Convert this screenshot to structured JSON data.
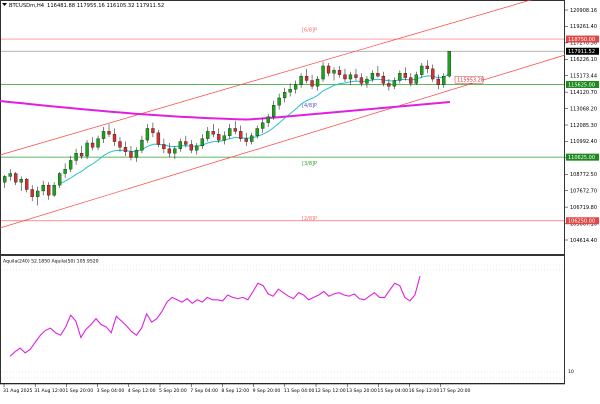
{
  "header": {
    "symbol": "BTCUSDm,H4",
    "ohlc": "116481.88 117955.16 116105.32 117911.52"
  },
  "indicator": {
    "label": "Aquila(240) 52.1850 Aquila(50) 105.9520",
    "scale": {
      "top": "",
      "mid": "",
      "bottom": "10"
    }
  },
  "murrey_labels": [
    {
      "text": "[6/8]P",
      "price": 119200
    },
    {
      "text": "[4/8]P",
      "price": 114000
    },
    {
      "text": "[3/8]P",
      "price": 110000
    },
    {
      "text": "[2/8]P",
      "price": 106250
    }
  ],
  "price_scale_labels": [
    "120908.16",
    "119261.40",
    "117270.56",
    "116226.10",
    "115173.44",
    "114120.70",
    "113068.20",
    "112085.30",
    "110992.40",
    "109979.80",
    "108772.50",
    "107672.70",
    "106719.80",
    "105667.10",
    "104614.40"
  ],
  "price_tags": [
    {
      "text": "118750.00",
      "color": "#e04848",
      "price": 118750
    },
    {
      "text": "117911.52",
      "color": "#000000",
      "price": 117911
    },
    {
      "text": "115625.00",
      "color": "#1e8a1e",
      "price": 115625
    },
    {
      "text": "110625.00",
      "color": "#1e8a1e",
      "price": 110625
    },
    {
      "text": "106250.00",
      "color": "#e04848",
      "price": 106250
    }
  ],
  "inline_tag": {
    "text": "115953.28",
    "price": 115953
  },
  "time_labels": [
    "31 Aug 2025",
    "31 Aug 12:00",
    "1 Sep 20:00",
    "3 Sep 04:00",
    "4 Sep 12:00",
    "5 Sep 20:00",
    "7 Sep 04:00",
    "8 Sep 12:00",
    "9 Sep 20:00",
    "11 Sep 04:00",
    "12 Sep 12:00",
    "13 Sep 20:00",
    "15 Sep 04:00",
    "16 Sep 12:00",
    "17 Sep 20:00"
  ],
  "colors": {
    "bull": "#1aa31a",
    "bear": "#d03030",
    "ma_fast": "#27c2c9",
    "ma_slow": "#e020e0",
    "channel": "#ff4040",
    "level_red": "#ff6a6a",
    "level_green": "#2aa02a",
    "oscillator": "#e020e0"
  },
  "chart_data": {
    "type": "candlestick",
    "y_range": [
      104100,
      121300
    ],
    "candles": [
      [
        108900,
        109400,
        108500,
        109300
      ],
      [
        109300,
        109800,
        109000,
        109500
      ],
      [
        109500,
        109600,
        108700,
        108900
      ],
      [
        108900,
        109300,
        108300,
        109100
      ],
      [
        109100,
        109200,
        108200,
        108400
      ],
      [
        108400,
        108700,
        107600,
        107900
      ],
      [
        107900,
        108600,
        107300,
        108300
      ],
      [
        108300,
        109000,
        108000,
        108700
      ],
      [
        108700,
        108900,
        107700,
        108000
      ],
      [
        108000,
        108900,
        107900,
        108700
      ],
      [
        108700,
        109600,
        108500,
        109500
      ],
      [
        109500,
        110200,
        109200,
        109800
      ],
      [
        109800,
        110700,
        109600,
        110400
      ],
      [
        110400,
        111200,
        110100,
        110900
      ],
      [
        110900,
        111400,
        110500,
        110700
      ],
      [
        110700,
        111800,
        110500,
        111600
      ],
      [
        111600,
        112000,
        111100,
        111300
      ],
      [
        111300,
        112100,
        111100,
        111900
      ],
      [
        111900,
        112700,
        111600,
        112400
      ],
      [
        112400,
        112900,
        112000,
        112200
      ],
      [
        112200,
        112600,
        111400,
        111700
      ],
      [
        111700,
        112000,
        111000,
        111300
      ],
      [
        111300,
        111700,
        110700,
        111000
      ],
      [
        111000,
        111400,
        110400,
        110600
      ],
      [
        110600,
        111300,
        110300,
        111100
      ],
      [
        111100,
        112100,
        110900,
        111800
      ],
      [
        111800,
        112900,
        111600,
        112600
      ],
      [
        112600,
        113000,
        112000,
        112300
      ],
      [
        112300,
        112500,
        111300,
        111500
      ],
      [
        111500,
        111900,
        110900,
        111200
      ],
      [
        111200,
        111600,
        110600,
        110900
      ],
      [
        110900,
        111400,
        110500,
        111200
      ],
      [
        111200,
        111900,
        111000,
        111700
      ],
      [
        111700,
        112100,
        111300,
        111500
      ],
      [
        111500,
        111800,
        110900,
        111100
      ],
      [
        111100,
        111600,
        110800,
        111400
      ],
      [
        111400,
        112200,
        111200,
        111900
      ],
      [
        111900,
        112700,
        111700,
        112400
      ],
      [
        112400,
        112900,
        112000,
        112200
      ],
      [
        112200,
        112600,
        111600,
        111800
      ],
      [
        111800,
        112400,
        111500,
        112100
      ],
      [
        112100,
        112900,
        111900,
        112600
      ],
      [
        112600,
        113100,
        112200,
        112400
      ],
      [
        112400,
        112800,
        111700,
        111900
      ],
      [
        111900,
        112300,
        111400,
        111700
      ],
      [
        111700,
        112300,
        111500,
        112100
      ],
      [
        112100,
        112800,
        111900,
        112600
      ],
      [
        112600,
        113300,
        112300,
        113000
      ],
      [
        113000,
        113600,
        112700,
        113400
      ],
      [
        113400,
        114500,
        113200,
        114200
      ],
      [
        114200,
        115000,
        113900,
        114700
      ],
      [
        114700,
        115400,
        114400,
        115100
      ],
      [
        115100,
        115700,
        114800,
        115300
      ],
      [
        115300,
        115900,
        115000,
        115600
      ],
      [
        115600,
        116400,
        115400,
        116200
      ],
      [
        116200,
        116700,
        115700,
        115900
      ],
      [
        115900,
        116300,
        115300,
        115500
      ],
      [
        115500,
        116200,
        115200,
        116000
      ],
      [
        116000,
        117200,
        115800,
        116900
      ],
      [
        116900,
        117100,
        116200,
        116400
      ],
      [
        116400,
        116800,
        115900,
        116600
      ],
      [
        116600,
        116900,
        116100,
        116300
      ],
      [
        116300,
        116700,
        115800,
        116000
      ],
      [
        116000,
        116500,
        115600,
        116300
      ],
      [
        116300,
        116700,
        115900,
        116100
      ],
      [
        116100,
        116400,
        115500,
        115700
      ],
      [
        115700,
        116200,
        115400,
        116000
      ],
      [
        116000,
        116600,
        115800,
        116400
      ],
      [
        116400,
        116900,
        116100,
        116200
      ],
      [
        116200,
        116500,
        115500,
        115700
      ],
      [
        115700,
        116000,
        115200,
        115500
      ],
      [
        115500,
        116100,
        115300,
        115900
      ],
      [
        115900,
        116600,
        115700,
        116400
      ],
      [
        116400,
        116800,
        115900,
        116100
      ],
      [
        116100,
        116400,
        115500,
        115700
      ],
      [
        115700,
        116500,
        115600,
        116300
      ],
      [
        116300,
        117100,
        116100,
        116900
      ],
      [
        116900,
        117300,
        116400,
        116700
      ],
      [
        116700,
        117000,
        115800,
        116000
      ],
      [
        116000,
        116300,
        115300,
        115600
      ],
      [
        115600,
        116400,
        115400,
        116200
      ],
      [
        116200,
        117911,
        116100,
        117911
      ]
    ],
    "oscillator": [
      20,
      24,
      27,
      23,
      26,
      32,
      38,
      42,
      44,
      40,
      38,
      45,
      55,
      50,
      36,
      43,
      47,
      52,
      47,
      45,
      40,
      54,
      50,
      46,
      41,
      38,
      44,
      56,
      49,
      52,
      58,
      66,
      70,
      68,
      66,
      69,
      65,
      68,
      66,
      70,
      68,
      68,
      67,
      72,
      70,
      69,
      70,
      68,
      75,
      82,
      80,
      73,
      71,
      77,
      74,
      71,
      69,
      74,
      72,
      68,
      70,
      72,
      75,
      71,
      73,
      74,
      72,
      71,
      73,
      69,
      68,
      71,
      74,
      70,
      70,
      76,
      82,
      80,
      70,
      67,
      72,
      88
    ]
  }
}
